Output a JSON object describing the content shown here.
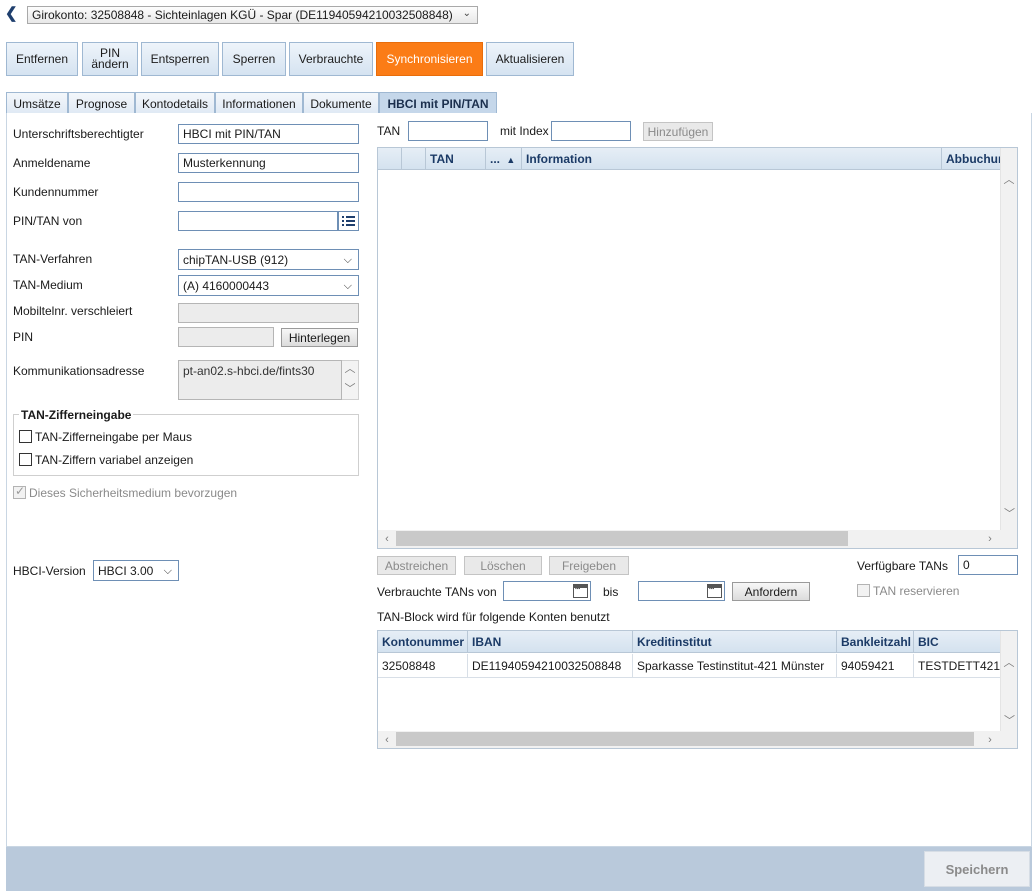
{
  "account_selector": {
    "value": "Girokonto: 32508848 - Sichteinlagen KGÜ - Spar (DE11940594210032508848)"
  },
  "toolbar": {
    "entfernen": "Entfernen",
    "pin_aendern_1": "PIN",
    "pin_aendern_2": "ändern",
    "entsperren": "Entsperren",
    "sperren": "Sperren",
    "verbrauchte": "Verbrauchte",
    "synchronisieren": "Synchronisieren",
    "aktualisieren": "Aktualisieren"
  },
  "tabs": {
    "umsaetze": "Umsätze",
    "prognose": "Prognose",
    "kontodetails": "Kontodetails",
    "informationen": "Informationen",
    "dokumente": "Dokumente",
    "hbci": "HBCI mit PIN/TAN"
  },
  "form": {
    "unterschrift_label": "Unterschriftsberechtigter",
    "unterschrift_value": "HBCI mit PIN/TAN",
    "anmeldename_label": "Anmeldename",
    "anmeldename_value": "Musterkennung",
    "kundennummer_label": "Kundennummer",
    "kundennummer_value": "",
    "pintan_von_label": "PIN/TAN von",
    "pintan_von_value": "",
    "tan_verfahren_label": "TAN-Verfahren",
    "tan_verfahren_value": "chipTAN-USB (912)",
    "tan_medium_label": "TAN-Medium",
    "tan_medium_value": "(A) 4160000443",
    "mobilnr_label": "Mobiltelnr. verschleiert",
    "mobilnr_value": "",
    "pin_label": "PIN",
    "pin_value": "",
    "hinterlegen": "Hinterlegen",
    "kommunikation_label": "Kommunikationsadresse",
    "kommunikation_value": "pt-an02.s-hbci.de/fints30",
    "group_title": "TAN-Zifferneingabe",
    "check_maus": "TAN-Zifferneingabe per Maus",
    "check_variabel": "TAN-Ziffern variabel anzeigen",
    "check_bevorzugen": "Dieses Sicherheitsmedium bevorzugen",
    "hbci_version_label": "HBCI-Version",
    "hbci_version_value": "HBCI 3.00"
  },
  "tan_panel": {
    "tan_label": "TAN",
    "tan_value": "",
    "index_label": "mit Index",
    "index_value": "",
    "hinzufuegen": "Hinzufügen",
    "columns": {
      "tan": "TAN",
      "dots": "...",
      "information": "Information",
      "abbuchung": "Abbuchur"
    },
    "abstreichen": "Abstreichen",
    "loeschen": "Löschen",
    "freigeben": "Freigeben",
    "verfuegbare_label": "Verfügbare TANs",
    "verfuegbare_value": "0",
    "verbrauchte_label": "Verbrauchte TANs von",
    "bis_label": "bis",
    "anfordern": "Anfordern",
    "reservieren": "TAN reservieren",
    "tanblock_label": "TAN-Block wird für folgende Konten benutzt"
  },
  "konten_table": {
    "columns": [
      "Kontonummer",
      "IBAN",
      "Kreditinstitut",
      "Bankleitzahl",
      "BIC"
    ],
    "rows": [
      [
        "32508848",
        "DE11940594210032508848",
        "Sparkasse Testinstitut-421 Münster",
        "94059421",
        "TESTDETT421"
      ]
    ]
  },
  "footer": {
    "speichern": "Speichern"
  },
  "colors": {
    "accent": "#fb7c16",
    "header_text": "#1b3a66",
    "footer_bar": "#b9c9db"
  },
  "icons": [
    "back-arrow-icon",
    "chevron-down-icon",
    "list-picker-icon",
    "sort-asc-icon",
    "calendar-icon",
    "scroll-left-icon",
    "scroll-right-icon",
    "scroll-up-icon",
    "scroll-down-icon"
  ]
}
